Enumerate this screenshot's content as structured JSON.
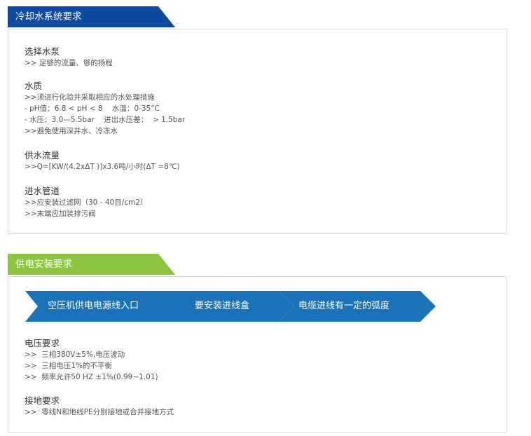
{
  "cooling": {
    "tab_title": "冷却水系统要求",
    "pump": {
      "title": "选择水泵",
      "lines": [
        ">> 足够的流量、够的扬程"
      ]
    },
    "quality": {
      "title": "水质",
      "lines": [
        ">>须进行化验并采取相应的水处理措施",
        "- pH值：6.8 < pH < 8    水温：0-35°C",
        "- 水压：3.0—5.5bar    进出水压差：  > 1.5bar",
        ">>避免使用深井水、冷冻水"
      ]
    },
    "flow": {
      "title": "供水流量",
      "lines": [
        ">>Q=[KW/(4.2xΔT )]x3.6吨/小时(ΔT =8℃)"
      ]
    },
    "inlet": {
      "title": "进水管道",
      "lines": [
        ">>应安装过滤网（30 - 40目/cm2）",
        ">>末端应加装排污阀"
      ]
    }
  },
  "power": {
    "tab_title": "供电安装要求",
    "steps": [
      "空压机供电电源线入口",
      "要安装进线盒",
      "电缆进线有一定的弧度"
    ],
    "voltage": {
      "title": "电压要求",
      "lines": [
        ">>  三相380V±5%,电压波动",
        ">>  三相电压1%的不平衡",
        ">>  频率允许50 HZ ±1%(0.99~1.01)"
      ]
    },
    "ground": {
      "title": "接地要求",
      "lines": [
        ">>  零线N和地线PE分别接地或合并接地方式"
      ]
    }
  },
  "colors": {
    "cooling_tab": "#0b4aa0",
    "power_tab": "#8cc63f",
    "step_arrow": "#1a73b8",
    "panel_border": "#dcdcdc"
  }
}
